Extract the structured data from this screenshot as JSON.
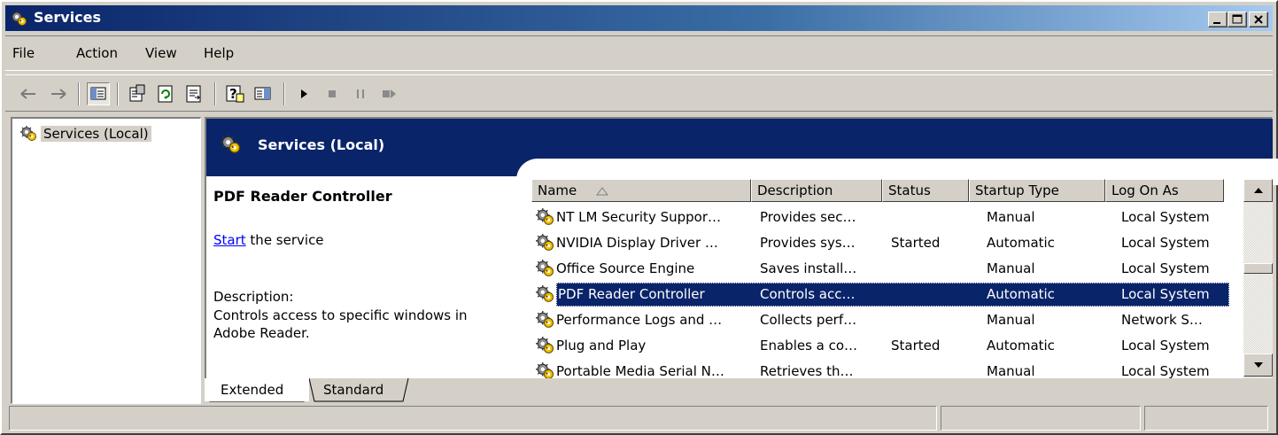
{
  "window": {
    "title": "Services",
    "icon": "services-gears-icon"
  },
  "menu": {
    "items": [
      "File",
      "Action",
      "View",
      "Help"
    ]
  },
  "toolbar": {
    "buttons": [
      "back-icon",
      "forward-icon",
      "show-hide-console-tree-icon",
      "properties-icon",
      "refresh-icon",
      "export-list-icon",
      "help-icon",
      "show-hide-action-pane-icon",
      "start-service-icon",
      "stop-service-icon",
      "pause-service-icon",
      "restart-service-icon"
    ]
  },
  "tree": {
    "root_label": "Services (Local)"
  },
  "banner": {
    "title": "Services (Local)"
  },
  "extended": {
    "service_name": "PDF Reader Controller",
    "start_link": "Start",
    "start_suffix": " the service",
    "description_label": "Description:",
    "description_text": "Controls access to specific windows in Adobe Reader."
  },
  "list": {
    "columns": [
      "Name",
      "Description",
      "Status",
      "Startup Type",
      "Log On As"
    ],
    "rows": [
      {
        "name": "NT LM Security Suppor…",
        "description": "Provides sec…",
        "status": "",
        "startup": "Manual",
        "logon": "Local System"
      },
      {
        "name": "NVIDIA Display Driver …",
        "description": "Provides sys…",
        "status": "Started",
        "startup": "Automatic",
        "logon": "Local System"
      },
      {
        "name": "Office Source Engine",
        "description": "Saves install…",
        "status": "",
        "startup": "Manual",
        "logon": "Local System"
      },
      {
        "name": "PDF Reader Controller",
        "description": "Controls acc…",
        "status": "",
        "startup": "Automatic",
        "logon": "Local System",
        "selected": true
      },
      {
        "name": "Performance Logs and …",
        "description": "Collects perf…",
        "status": "",
        "startup": "Manual",
        "logon": "Network S…"
      },
      {
        "name": "Plug and Play",
        "description": "Enables a co…",
        "status": "Started",
        "startup": "Automatic",
        "logon": "Local System"
      },
      {
        "name": "Portable Media Serial N…",
        "description": "Retrieves th…",
        "status": "",
        "startup": "Manual",
        "logon": "Local System"
      }
    ]
  },
  "tabs": {
    "extended": "Extended",
    "standard": "Standard"
  },
  "colors": {
    "selection": "#0a246a",
    "banner": "#0a246a",
    "face": "#d4d0c8",
    "link": "#0000ff"
  }
}
